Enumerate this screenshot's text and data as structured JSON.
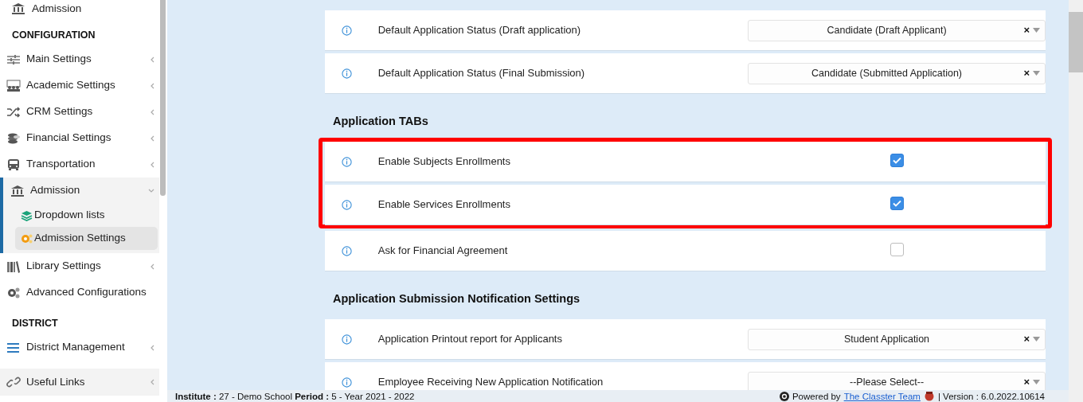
{
  "sidebar": {
    "top_item": {
      "label": "Admission"
    },
    "sections": [
      {
        "heading": "CONFIGURATION",
        "items": [
          {
            "label": "Main Settings",
            "expanded": false,
            "selected": false
          },
          {
            "label": "Academic Settings",
            "expanded": false,
            "selected": false
          },
          {
            "label": "CRM Settings",
            "expanded": false,
            "selected": false
          },
          {
            "label": "Financial Settings",
            "expanded": false,
            "selected": false
          },
          {
            "label": "Transportation",
            "expanded": false,
            "selected": false
          },
          {
            "label": "Admission",
            "expanded": true,
            "selected": true,
            "children": [
              {
                "label": "Dropdown lists",
                "selected": false
              },
              {
                "label": "Admission Settings",
                "selected": true
              }
            ]
          },
          {
            "label": "Library Settings",
            "expanded": false,
            "selected": false
          },
          {
            "label": "Advanced Configurations",
            "selected": false
          }
        ]
      },
      {
        "heading": "DISTRICT",
        "items": [
          {
            "label": "District Management",
            "expanded": false,
            "selected": false
          }
        ]
      }
    ],
    "bottom_item": {
      "label": "Useful Links",
      "expanded": false
    }
  },
  "settings": [
    {
      "rows": [
        {
          "kind": "select",
          "label": "Default Application Status (Draft application)",
          "value": "Candidate (Draft Applicant)",
          "clear": "×",
          "highlighted": false
        },
        {
          "kind": "select",
          "label": "Default Application Status (Final Submission)",
          "value": "Candidate (Submitted Application)",
          "clear": "×",
          "highlighted": false
        }
      ]
    },
    {
      "heading": "Application TABs",
      "rows": [
        {
          "kind": "checkbox",
          "label": "Enable Subjects Enrollments",
          "checked": true,
          "highlighted": true
        },
        {
          "kind": "checkbox",
          "label": "Enable Services Enrollments",
          "checked": true,
          "highlighted": true
        },
        {
          "kind": "checkbox",
          "label": "Ask for Financial Agreement",
          "checked": false,
          "highlighted": false
        }
      ]
    },
    {
      "heading": "Application Submission Notification Settings",
      "rows": [
        {
          "kind": "select",
          "label": "Application Printout report for Applicants",
          "value": "Student Application",
          "clear": "×",
          "highlighted": false
        },
        {
          "kind": "select",
          "label": "Employee Receiving New Application Notification",
          "value": "--Please Select--",
          "clear": "×",
          "highlighted": false
        }
      ]
    }
  ],
  "footer": {
    "info": "**Institute :** 27 - Demo School **Period :** 5 - Year 2021 - 2022",
    "powered_by": "Powered by",
    "team_link": "The Classter Team",
    "version": "| Version : 6.0.2022.10614"
  }
}
